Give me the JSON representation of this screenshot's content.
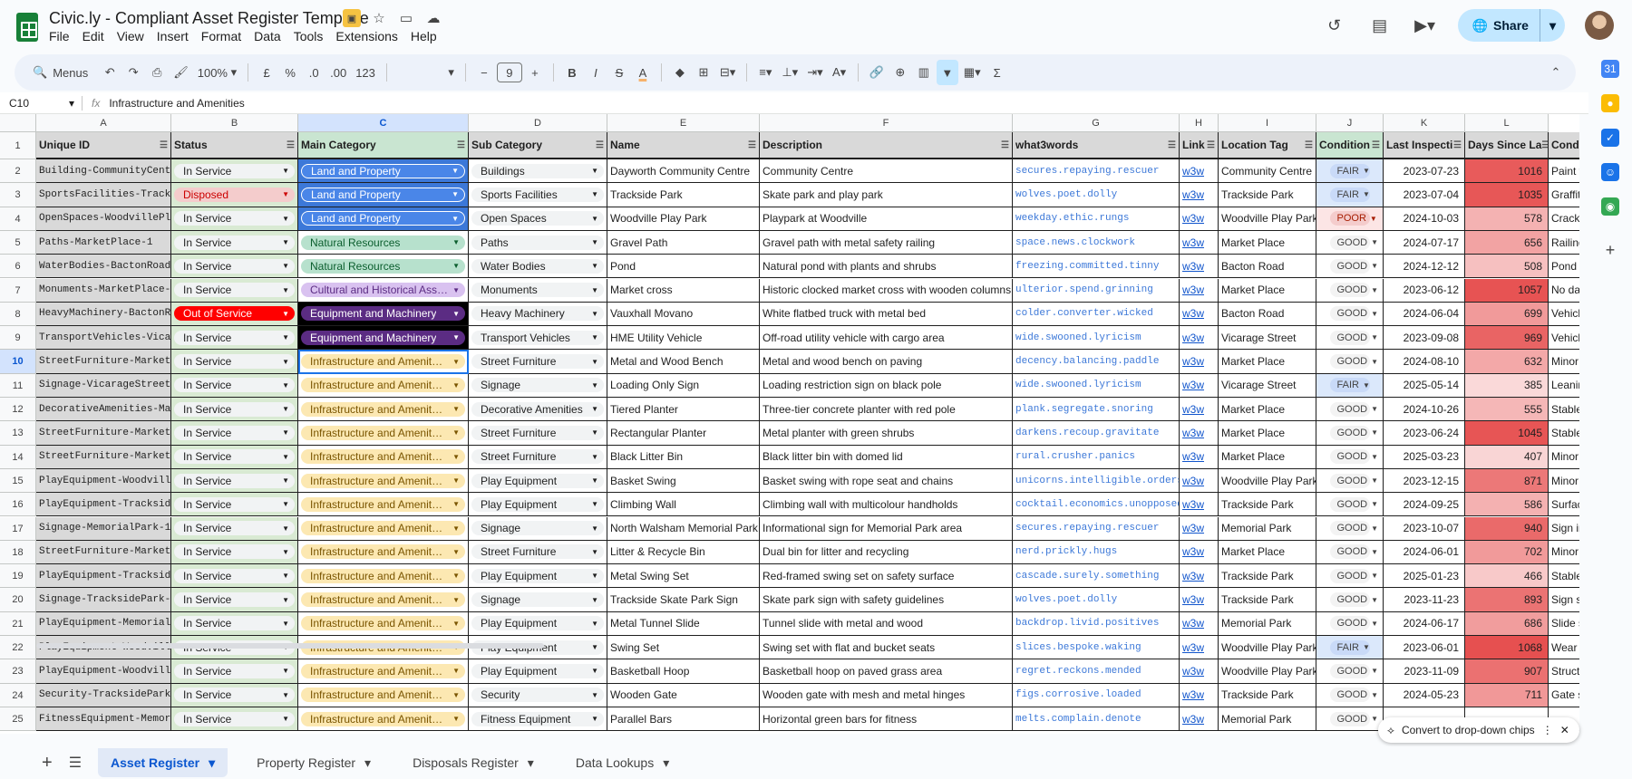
{
  "app": {
    "title": "Civic.ly - Compliant Asset Register Template",
    "menus": [
      "File",
      "Edit",
      "View",
      "Insert",
      "Format",
      "Data",
      "Tools",
      "Extensions",
      "Help"
    ],
    "share_label": "Share"
  },
  "toolbar": {
    "search_label": "Menus",
    "zoom": "100%",
    "currency": "£",
    "percent": "%",
    "dec_less": ".0",
    "dec_more": ".00",
    "number_fmt": "123",
    "font_size": "9",
    "minus": "−",
    "plus": "+",
    "bold": "B",
    "italic": "I",
    "strike": "S",
    "text_color": "A",
    "sigma": "Σ"
  },
  "formula": {
    "name_box": "C10",
    "fx": "fx",
    "value": "Infrastructure and Amenities"
  },
  "columns": [
    "A",
    "B",
    "C",
    "D",
    "E",
    "F",
    "G",
    "H",
    "I",
    "J",
    "K",
    "L"
  ],
  "headers": [
    "Unique ID",
    "Status",
    "Main Category",
    "Sub Category",
    "Name",
    "Description",
    "what3words",
    "Link",
    "Location Tag",
    "Condition",
    "Last Inspecti",
    "Days Since La",
    "Condi"
  ],
  "rows": [
    {
      "n": "2",
      "id": "Building-CommunityCentr",
      "status": "In Service",
      "main": "Land and Property",
      "sub": "Buildings",
      "name": "Dayworth Community Centre",
      "desc": "Community Centre",
      "w3w": "secures.repaying.rescuer",
      "link": "w3w",
      "loc": "Community Centre",
      "cond": "FAIR",
      "date": "2023-07-23",
      "days": "1016",
      "extra": "Paint f"
    },
    {
      "n": "3",
      "id": "SportsFacilities-Tracks",
      "status": "Disposed",
      "main": "Land and Property",
      "sub": "Sports Facilities",
      "name": "Trackside Park",
      "desc": "Skate park and play park",
      "w3w": "wolves.poet.dolly",
      "link": "w3w",
      "loc": "Trackside Park",
      "cond": "FAIR",
      "date": "2023-07-04",
      "days": "1035",
      "extra": "Graffiti"
    },
    {
      "n": "4",
      "id": "OpenSpaces-WoodvillePla",
      "status": "In Service",
      "main": "Land and Property",
      "sub": "Open Spaces",
      "name": "Woodville Play Park",
      "desc": "Playpark at Woodville",
      "w3w": "weekday.ethic.rungs",
      "link": "w3w",
      "loc": "Woodville Play Park",
      "cond": "POOR",
      "date": "2024-10-03",
      "days": "578",
      "extra": "Crack"
    },
    {
      "n": "5",
      "id": "Paths-MarketPlace-1",
      "status": "In Service",
      "main": "Natural Resources",
      "sub": "Paths",
      "name": "Gravel Path",
      "desc": "Gravel path with metal safety railing",
      "w3w": "space.news.clockwork",
      "link": "w3w",
      "loc": "Market Place",
      "cond": "GOOD",
      "date": "2024-07-17",
      "days": "656",
      "extra": "Railing"
    },
    {
      "n": "6",
      "id": "WaterBodies-BactonRoad-",
      "status": "In Service",
      "main": "Natural Resources",
      "sub": "Water Bodies",
      "name": "Pond",
      "desc": "Natural pond with plants and shrubs",
      "w3w": "freezing.committed.tinny",
      "link": "w3w",
      "loc": "Bacton Road",
      "cond": "GOOD",
      "date": "2024-12-12",
      "days": "508",
      "extra": "Pond d"
    },
    {
      "n": "7",
      "id": "Monuments-MarketPlace-1",
      "status": "In Service",
      "main": "Cultural and Historical Ass…",
      "sub": "Monuments",
      "name": "Market cross",
      "desc": "Historic clocked market cross with wooden columns",
      "w3w": "ulterior.spend.grinning",
      "link": "w3w",
      "loc": "Market Place",
      "cond": "GOOD",
      "date": "2023-06-12",
      "days": "1057",
      "extra": "No dar"
    },
    {
      "n": "8",
      "id": "HeavyMachinery-BactonRo",
      "status": "Out of Service",
      "main": "Equipment and Machinery",
      "sub": "Heavy Machinery",
      "name": "Vauxhall Movano",
      "desc": "White flatbed truck with metal bed",
      "w3w": "colder.converter.wicked",
      "link": "w3w",
      "loc": "Bacton Road",
      "cond": "GOOD",
      "date": "2024-06-04",
      "days": "699",
      "extra": "Vehicl"
    },
    {
      "n": "9",
      "id": "TransportVehicles-Vicar",
      "status": "In Service",
      "main": "Equipment and Machinery",
      "sub": "Transport Vehicles",
      "name": "HME Utility Vehicle",
      "desc": "Off-road utility vehicle with cargo area",
      "w3w": "wide.swooned.lyricism",
      "link": "w3w",
      "loc": "Vicarage Street",
      "cond": "GOOD",
      "date": "2023-09-08",
      "days": "969",
      "extra": "Vehicl"
    },
    {
      "n": "10",
      "id": "StreetFurniture-MarketP",
      "status": "In Service",
      "main": "Infrastructure and Amenit…",
      "sub": "Street Furniture",
      "name": "Metal and Wood Bench",
      "desc": "Metal and wood bench on paving",
      "w3w": "decency.balancing.paddle",
      "link": "w3w",
      "loc": "Market Place",
      "cond": "GOOD",
      "date": "2024-08-10",
      "days": "632",
      "extra": "Minor"
    },
    {
      "n": "11",
      "id": "Signage-VicarageStreet-",
      "status": "In Service",
      "main": "Infrastructure and Amenit…",
      "sub": "Signage",
      "name": "Loading Only Sign",
      "desc": "Loading restriction sign on black pole",
      "w3w": "wide.swooned.lyricism",
      "link": "w3w",
      "loc": "Vicarage Street",
      "cond": "FAIR",
      "date": "2025-05-14",
      "days": "385",
      "extra": "Leanin"
    },
    {
      "n": "12",
      "id": "DecorativeAmenities-Mar",
      "status": "In Service",
      "main": "Infrastructure and Amenit…",
      "sub": "Decorative Amenities",
      "name": "Tiered Planter",
      "desc": "Three-tier concrete planter with red pole",
      "w3w": "plank.segregate.snoring",
      "link": "w3w",
      "loc": "Market Place",
      "cond": "GOOD",
      "date": "2024-10-26",
      "days": "555",
      "extra": "Stable"
    },
    {
      "n": "13",
      "id": "StreetFurniture-MarketP",
      "status": "In Service",
      "main": "Infrastructure and Amenit…",
      "sub": "Street Furniture",
      "name": "Rectangular Planter",
      "desc": "Metal planter with green shrubs",
      "w3w": "darkens.recoup.gravitate",
      "link": "w3w",
      "loc": "Market Place",
      "cond": "GOOD",
      "date": "2023-06-24",
      "days": "1045",
      "extra": "Stable"
    },
    {
      "n": "14",
      "id": "StreetFurniture-MarketP",
      "status": "In Service",
      "main": "Infrastructure and Amenit…",
      "sub": "Street Furniture",
      "name": "Black Litter Bin",
      "desc": "Black litter bin with domed lid",
      "w3w": "rural.crusher.panics",
      "link": "w3w",
      "loc": "Market Place",
      "cond": "GOOD",
      "date": "2025-03-23",
      "days": "407",
      "extra": "Minor"
    },
    {
      "n": "15",
      "id": "PlayEquipment-Woodville",
      "status": "In Service",
      "main": "Infrastructure and Amenit…",
      "sub": "Play Equipment",
      "name": "Basket Swing",
      "desc": "Basket swing with rope seat and chains",
      "w3w": "unicorns.intelligible.orders",
      "link": "w3w",
      "loc": "Woodville Play Park",
      "cond": "GOOD",
      "date": "2023-12-15",
      "days": "871",
      "extra": "Minor"
    },
    {
      "n": "16",
      "id": "PlayEquipment-Trackside",
      "status": "In Service",
      "main": "Infrastructure and Amenit…",
      "sub": "Play Equipment",
      "name": "Climbing Wall",
      "desc": "Climbing wall with multicolour handholds",
      "w3w": "cocktail.economics.unopposed",
      "link": "w3w",
      "loc": "Trackside Park",
      "cond": "GOOD",
      "date": "2024-09-25",
      "days": "586",
      "extra": "Surfac"
    },
    {
      "n": "17",
      "id": "Signage-MemorialPark-1",
      "status": "In Service",
      "main": "Infrastructure and Amenit…",
      "sub": "Signage",
      "name": "North Walsham Memorial Park",
      "desc": "Informational sign for Memorial Park area",
      "w3w": "secures.repaying.rescuer",
      "link": "w3w",
      "loc": "Memorial Park",
      "cond": "GOOD",
      "date": "2023-10-07",
      "days": "940",
      "extra": "Sign in"
    },
    {
      "n": "18",
      "id": "StreetFurniture-MarketP",
      "status": "In Service",
      "main": "Infrastructure and Amenit…",
      "sub": "Street Furniture",
      "name": "Litter & Recycle Bin",
      "desc": "Dual bin for litter and recycling",
      "w3w": "nerd.prickly.hugs",
      "link": "w3w",
      "loc": "Market Place",
      "cond": "GOOD",
      "date": "2024-06-01",
      "days": "702",
      "extra": "Minor"
    },
    {
      "n": "19",
      "id": "PlayEquipment-Trackside",
      "status": "In Service",
      "main": "Infrastructure and Amenit…",
      "sub": "Play Equipment",
      "name": "Metal Swing Set",
      "desc": "Red-framed swing set on safety surface",
      "w3w": "cascade.surely.something",
      "link": "w3w",
      "loc": "Trackside Park",
      "cond": "GOOD",
      "date": "2025-01-23",
      "days": "466",
      "extra": "Stable"
    },
    {
      "n": "20",
      "id": "Signage-TracksidePark-1",
      "status": "In Service",
      "main": "Infrastructure and Amenit…",
      "sub": "Signage",
      "name": "Trackside Skate Park Sign",
      "desc": "Skate park sign with safety guidelines",
      "w3w": "wolves.poet.dolly",
      "link": "w3w",
      "loc": "Trackside Park",
      "cond": "GOOD",
      "date": "2023-11-23",
      "days": "893",
      "extra": "Sign s"
    },
    {
      "n": "21",
      "id": "PlayEquipment-MemorialP",
      "status": "In Service",
      "main": "Infrastructure and Amenit…",
      "sub": "Play Equipment",
      "name": "Metal Tunnel Slide",
      "desc": "Tunnel slide with metal and wood",
      "w3w": "backdrop.livid.positives",
      "link": "w3w",
      "loc": "Memorial Park",
      "cond": "GOOD",
      "date": "2024-06-17",
      "days": "686",
      "extra": "Slide s"
    },
    {
      "n": "22",
      "id": "PlayEquipment-Woodville",
      "status": "In Service",
      "main": "Infrastructure and Amenit…",
      "sub": "Play Equipment",
      "name": "Swing Set",
      "desc": "Swing set with flat and bucket seats",
      "w3w": "slices.bespoke.waking",
      "link": "w3w",
      "loc": "Woodville Play Park",
      "cond": "FAIR",
      "date": "2023-06-01",
      "days": "1068",
      "extra": "Wear"
    },
    {
      "n": "23",
      "id": "PlayEquipment-Woodville",
      "status": "In Service",
      "main": "Infrastructure and Amenit…",
      "sub": "Play Equipment",
      "name": "Basketball Hoop",
      "desc": "Basketball hoop on paved grass area",
      "w3w": "regret.reckons.mended",
      "link": "w3w",
      "loc": "Woodville Play Park",
      "cond": "GOOD",
      "date": "2023-11-09",
      "days": "907",
      "extra": "Struct"
    },
    {
      "n": "24",
      "id": "Security-TracksidePark-",
      "status": "In Service",
      "main": "Infrastructure and Amenit…",
      "sub": "Security",
      "name": "Wooden Gate",
      "desc": "Wooden gate with mesh and metal hinges",
      "w3w": "figs.corrosive.loaded",
      "link": "w3w",
      "loc": "Trackside Park",
      "cond": "GOOD",
      "date": "2024-05-23",
      "days": "711",
      "extra": "Gate s"
    },
    {
      "n": "25",
      "id": "FitnessEquipment-Memori",
      "status": "In Service",
      "main": "Infrastructure and Amenit…",
      "sub": "Fitness Equipment",
      "name": "Parallel Bars",
      "desc": "Horizontal green bars for fitness",
      "w3w": "melts.complain.denote",
      "link": "w3w",
      "loc": "Memorial Park",
      "cond": "GOOD",
      "date": "",
      "days": "",
      "extra": ""
    }
  ],
  "colors": {
    "land": "#4a86e8",
    "natural": "#b7e1cd",
    "cultural": "#d9c2f0",
    "equipment": "#5b2c83",
    "infra": "#fce8b2",
    "disposed": "#f4cccc",
    "outofservice": "#ff0000",
    "fair": "#c9daf8",
    "poor": "#f4cccc",
    "good": "#f3f3f3"
  },
  "sheets": [
    "Asset Register",
    "Property Register",
    "Disposals Register",
    "Data Lookups"
  ],
  "toast": "Convert to drop-down chips"
}
